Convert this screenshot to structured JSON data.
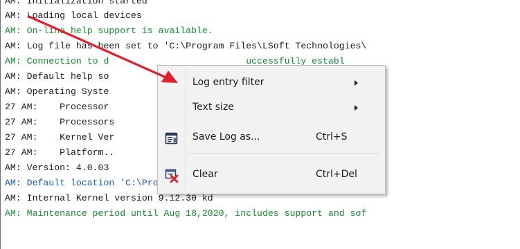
{
  "log_lines": [
    {
      "text": "AM: Initialization started",
      "color": "#1a1a1a"
    },
    {
      "text": "AM: Loading local devices",
      "color": "#1a1a1a"
    },
    {
      "text": "AM: On-line help support is available.",
      "color": "#138a2c"
    },
    {
      "text": "AM: Log file has been set to 'C:\\Program Files\\LSoft Technologies\\",
      "color": "#1a1a1a"
    },
    {
      "text": "AM: Connection to d                         uccessfully establ",
      "color": "#138a2c"
    },
    {
      "text": "AM: Default help so                         n Help'.",
      "color": "#1a1a1a"
    },
    {
      "text": "AM: Operating Syste                         rnal",
      "color": "#1a1a1a"
    },
    {
      "text": "27 AM:    Processor                         x64 (AMD or Intel",
      "color": "#1a1a1a"
    },
    {
      "text": "27 AM:    Processors                        12",
      "color": "#1a1a1a"
    },
    {
      "text": "27 AM:    Kernel Ver                        6.3.9600 (winnt)",
      "color": "#1a1a1a"
    },
    {
      "text": "27 AM:    Platform..                        64-bit",
      "color": "#1a1a1a"
    },
    {
      "text": "AM: Version: 4.0.03",
      "color": "#1a1a1a"
    },
    {
      "text": "AM: Default location 'C:\\Program Files\\LSoft Technologies\\KillDisk",
      "color": "#1a57b8"
    },
    {
      "text": "AM: Internal Kernel version 9.12.30 kd",
      "color": "#1a1a1a"
    },
    {
      "text": "AM: Maintenance period until Aug 18,2020, includes support and sof",
      "color": "#138a2c"
    }
  ],
  "context_menu": {
    "items": [
      {
        "label": "Log entry filter",
        "shortcut": "",
        "icon": "",
        "submenu": true
      },
      {
        "label": "Text size",
        "shortcut": "",
        "icon": "",
        "submenu": true
      },
      {
        "label": "Save Log as...",
        "shortcut": "Ctrl+S",
        "icon": "save-log-icon",
        "submenu": false
      },
      {
        "label": "Clear",
        "shortcut": "Ctrl+Del",
        "icon": "clear-log-icon",
        "submenu": false
      }
    ]
  },
  "annotation": {
    "arrow_color": "#e0202a"
  }
}
